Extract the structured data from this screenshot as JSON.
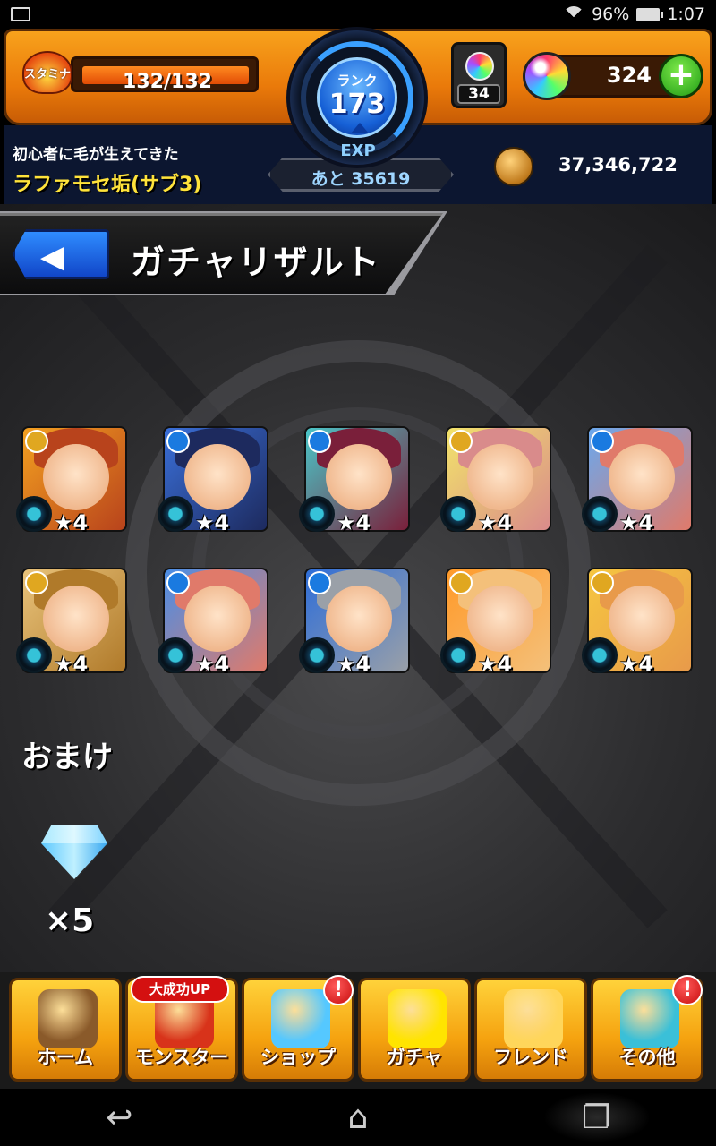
{
  "status_bar": {
    "battery": "96%",
    "time": "1:07"
  },
  "hud": {
    "stamina_label": "スタミナ",
    "stamina": "132/132",
    "rank_label": "ランク",
    "rank": "173",
    "exp_label": "EXP",
    "exp_remaining": "あと 35619",
    "orb_box_count": "34",
    "orb_count": "324",
    "player_subtitle": "初心者に毛が生えてきた",
    "player_name": "ラファモセ垢(サブ3)",
    "gold": "37,346,722"
  },
  "screen": {
    "title": "ガチャリザルト",
    "back_glyph": "◀"
  },
  "monsters": [
    {
      "rarity": "★4",
      "element": "light",
      "colors": [
        "#f3a020",
        "#b8431c"
      ]
    },
    {
      "rarity": "★4",
      "element": "water",
      "colors": [
        "#3a6fd8",
        "#1d2a5e"
      ]
    },
    {
      "rarity": "★4",
      "element": "water",
      "colors": [
        "#4ac6c8",
        "#7a1f3a"
      ]
    },
    {
      "rarity": "★4",
      "element": "light",
      "colors": [
        "#f2e36a",
        "#d98b8b"
      ]
    },
    {
      "rarity": "★4",
      "element": "water",
      "colors": [
        "#6aa8ee",
        "#e07a6a"
      ]
    },
    {
      "rarity": "★4",
      "element": "light",
      "colors": [
        "#e8c27a",
        "#b07a2a"
      ]
    },
    {
      "rarity": "★4",
      "element": "water",
      "colors": [
        "#4a8ee6",
        "#e07a6a"
      ]
    },
    {
      "rarity": "★4",
      "element": "water",
      "colors": [
        "#2f6ed8",
        "#9aa0a8"
      ]
    },
    {
      "rarity": "★4",
      "element": "light",
      "colors": [
        "#ff9a2a",
        "#f4c07a"
      ]
    },
    {
      "rarity": "★4",
      "element": "light",
      "colors": [
        "#f6c640",
        "#e89a4a"
      ]
    }
  ],
  "bonus": {
    "title": "おまけ",
    "gem_count": "×5"
  },
  "menu": [
    {
      "label": "ホーム",
      "icon": "home-gate-icon",
      "alert": "",
      "color": "#8a5a2a"
    },
    {
      "label": "モンスター",
      "icon": "monster-icon",
      "alert": "",
      "color": "#d8331a"
    },
    {
      "label": "ショップ",
      "icon": "rainbow-orb-icon",
      "alert": "!",
      "color": "#55c8ff"
    },
    {
      "label": "ガチャ",
      "icon": "egg-icon",
      "alert": "",
      "color": "#ffe400"
    },
    {
      "label": "フレンド",
      "icon": "friends-icon",
      "alert": "",
      "color": "#ffd65a"
    },
    {
      "label": "その他",
      "icon": "other-icon",
      "alert": "!",
      "color": "#3ac0d8"
    }
  ],
  "promo_badge": "大成功UP",
  "nav": {
    "back": "↩",
    "home": "⌂",
    "recents": "❐"
  }
}
